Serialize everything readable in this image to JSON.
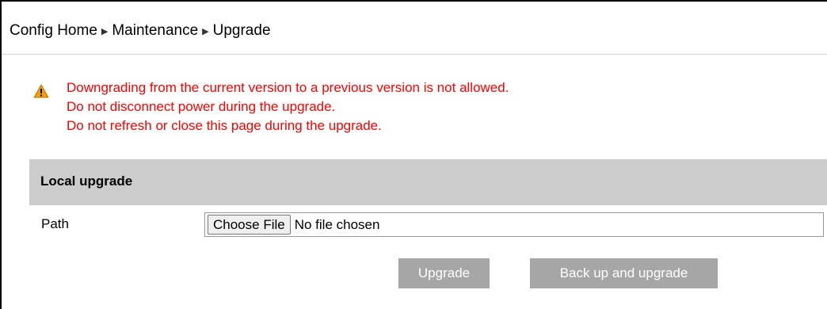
{
  "breadcrumb": {
    "items": [
      "Config Home",
      "Maintenance",
      "Upgrade"
    ],
    "separator": "▶"
  },
  "warning": {
    "icon": "warning-triangle-icon",
    "lines": [
      "Downgrading from the current version to a previous version is not allowed.",
      "Do not disconnect power during the upgrade.",
      "Do not refresh or close this page during the upgrade."
    ],
    "color": "#ff0000"
  },
  "local_upgrade": {
    "title": "Local upgrade",
    "path_label": "Path",
    "choose_file_label": "Choose File",
    "file_status": "No file chosen"
  },
  "buttons": {
    "upgrade": "Upgrade",
    "backup_upgrade": "Back up and upgrade"
  },
  "colors": {
    "section_header_bg": "#cccccc",
    "button_bg": "#a6a6a6",
    "button_text": "#ffffff",
    "warning_icon": "#f0a000"
  }
}
